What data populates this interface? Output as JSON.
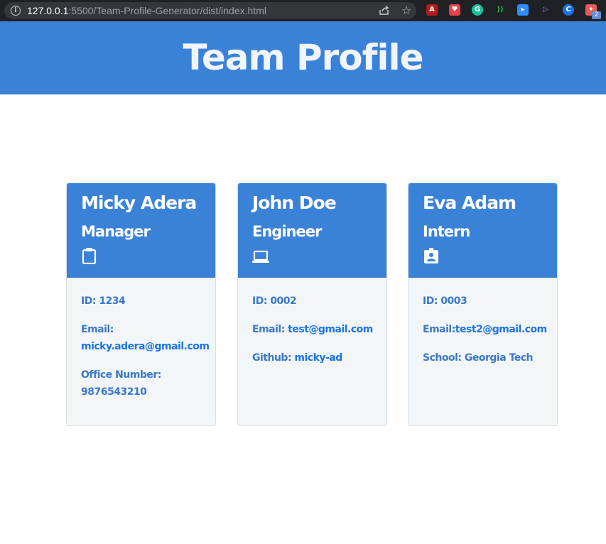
{
  "browser": {
    "url_host": "127.0.0.1",
    "url_path": ":5500/Team-Profile-Generator/dist/index.html",
    "extension_badge": "2"
  },
  "header": {
    "title": "Team Profile"
  },
  "colors": {
    "brand_blue": "#3a82d8",
    "card_body": "#f3f6f8",
    "text_blue": "#3a78c8",
    "link_blue": "#1a73e8"
  },
  "cards": [
    {
      "name": "Micky Adera",
      "role": "Manager",
      "icon": "clipboard-icon",
      "id_label": "ID: ",
      "id": "1234",
      "email_label": "Email:",
      "email": "micky.adera@gmail.com",
      "extra_label": "Office Number:",
      "extra_value": "9876543210"
    },
    {
      "name": "John Doe",
      "role": "Engineer",
      "icon": "laptop-icon",
      "id_label": "ID: ",
      "id": "0002",
      "email_label": "Email: ",
      "email": "test@gmail.com",
      "extra_label": "Github: ",
      "extra_value": "micky-ad"
    },
    {
      "name": "Eva Adam",
      "role": "Intern",
      "icon": "id-badge-icon",
      "id_label": "ID: ",
      "id": "0003",
      "email_label": "Email:",
      "email": "test2@gmail.com",
      "extra_label": "School: ",
      "extra_value": "Georgia Tech"
    }
  ]
}
